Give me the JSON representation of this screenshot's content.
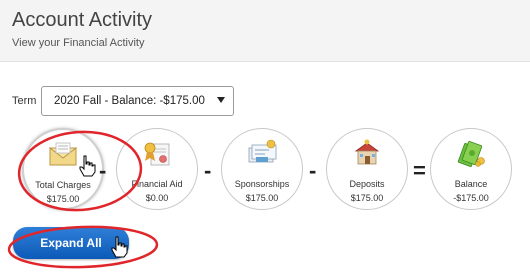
{
  "header": {
    "title": "Account Activity",
    "subtitle": "View your Financial Activity"
  },
  "term": {
    "label": "Term",
    "selected": "2020 Fall - Balance: -$175.00"
  },
  "summary": {
    "items": [
      {
        "label": "Total Charges",
        "amount": "$175.00",
        "icon": "envelope-icon"
      },
      {
        "label": "Financial Aid",
        "amount": "$0.00",
        "icon": "award-certificate-icon"
      },
      {
        "label": "Sponsorships",
        "amount": "$175.00",
        "icon": "check-payment-icon"
      },
      {
        "label": "Deposits",
        "amount": "$175.00",
        "icon": "bank-house-icon"
      },
      {
        "label": "Balance",
        "amount": "-$175.00",
        "icon": "money-cash-icon"
      }
    ],
    "operators": [
      "-",
      "-",
      "-",
      "="
    ]
  },
  "actions": {
    "expand_all": "Expand All"
  },
  "colors": {
    "button_blue": "#1a6bcc",
    "annotation_red": "#e0262a"
  }
}
